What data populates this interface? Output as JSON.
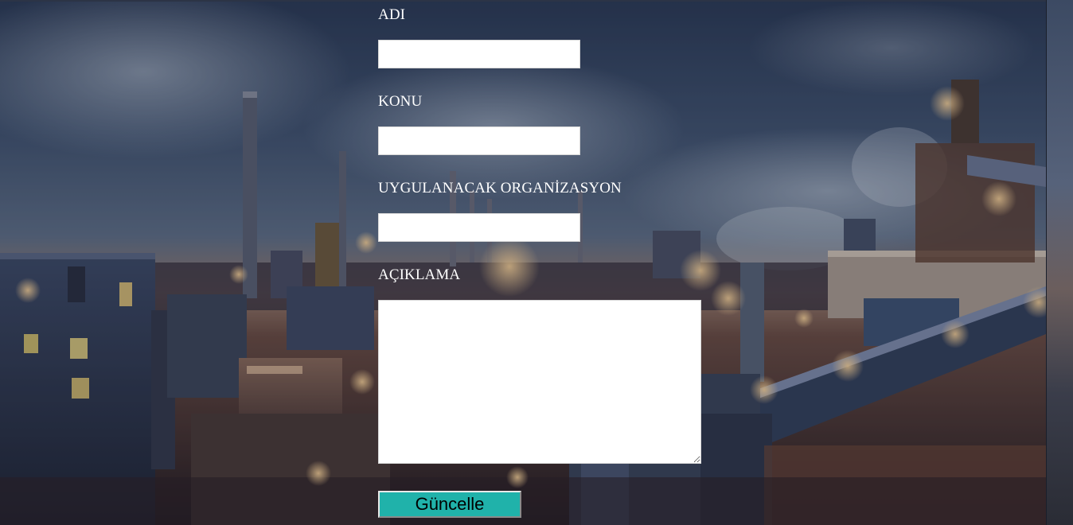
{
  "form": {
    "name_label": "ADI",
    "name_value": "",
    "subject_label": "KONU",
    "subject_value": "",
    "organization_label": "UYGULANACAK ORGANİZASYON",
    "organization_value": "",
    "description_label": "AÇIKLAMA",
    "description_value": "",
    "submit_label": "Güncelle"
  },
  "colors": {
    "button_background": "#20b2aa",
    "label_text": "#ffffff",
    "input_background": "#ffffff",
    "scene_sky": "#3f5573",
    "scene_glow": "#e0a060"
  },
  "icons": {
    "textarea_resize": "resize-grip-icon"
  }
}
